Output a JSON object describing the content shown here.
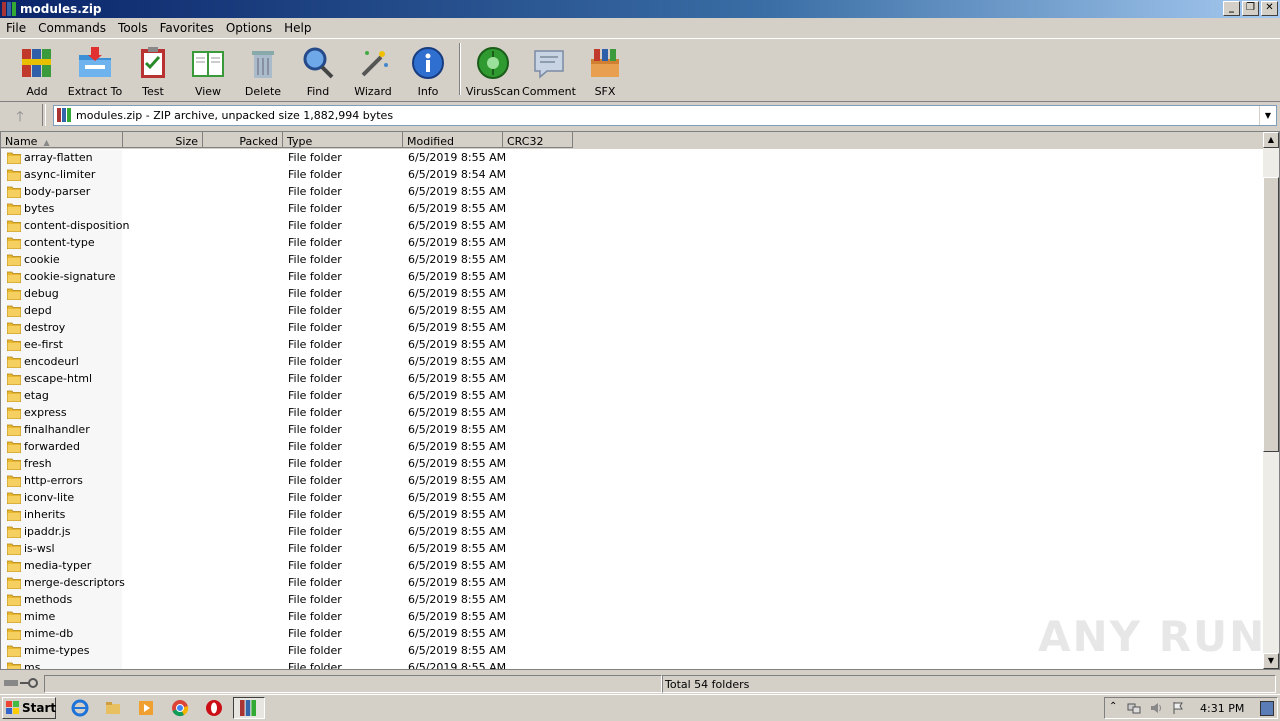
{
  "window": {
    "title": "modules.zip"
  },
  "menu": [
    "File",
    "Commands",
    "Tools",
    "Favorites",
    "Options",
    "Help"
  ],
  "toolbar": [
    {
      "label": "Add",
      "icon": "add-archive-icon"
    },
    {
      "label": "Extract To",
      "icon": "extract-folder-icon"
    },
    {
      "label": "Test",
      "icon": "test-clipboard-icon"
    },
    {
      "label": "View",
      "icon": "view-book-icon"
    },
    {
      "label": "Delete",
      "icon": "trash-can-icon"
    },
    {
      "label": "Find",
      "icon": "magnifier-icon"
    },
    {
      "label": "Wizard",
      "icon": "magic-wand-icon"
    },
    {
      "label": "Info",
      "icon": "info-icon"
    },
    {
      "label": "VirusScan",
      "icon": "virus-scan-icon"
    },
    {
      "label": "Comment",
      "icon": "comment-icon"
    },
    {
      "label": "SFX",
      "icon": "sfx-box-icon"
    }
  ],
  "address": {
    "text": "modules.zip - ZIP archive, unpacked size 1,882,994 bytes"
  },
  "columns": [
    "Name",
    "Size",
    "Packed",
    "Type",
    "Modified",
    "CRC32"
  ],
  "rows": [
    {
      "name": "array-flatten",
      "type": "File folder",
      "modified": "6/5/2019 8:55 AM"
    },
    {
      "name": "async-limiter",
      "type": "File folder",
      "modified": "6/5/2019 8:54 AM"
    },
    {
      "name": "body-parser",
      "type": "File folder",
      "modified": "6/5/2019 8:55 AM"
    },
    {
      "name": "bytes",
      "type": "File folder",
      "modified": "6/5/2019 8:55 AM"
    },
    {
      "name": "content-disposition",
      "type": "File folder",
      "modified": "6/5/2019 8:55 AM"
    },
    {
      "name": "content-type",
      "type": "File folder",
      "modified": "6/5/2019 8:55 AM"
    },
    {
      "name": "cookie",
      "type": "File folder",
      "modified": "6/5/2019 8:55 AM"
    },
    {
      "name": "cookie-signature",
      "type": "File folder",
      "modified": "6/5/2019 8:55 AM"
    },
    {
      "name": "debug",
      "type": "File folder",
      "modified": "6/5/2019 8:55 AM"
    },
    {
      "name": "depd",
      "type": "File folder",
      "modified": "6/5/2019 8:55 AM"
    },
    {
      "name": "destroy",
      "type": "File folder",
      "modified": "6/5/2019 8:55 AM"
    },
    {
      "name": "ee-first",
      "type": "File folder",
      "modified": "6/5/2019 8:55 AM"
    },
    {
      "name": "encodeurl",
      "type": "File folder",
      "modified": "6/5/2019 8:55 AM"
    },
    {
      "name": "escape-html",
      "type": "File folder",
      "modified": "6/5/2019 8:55 AM"
    },
    {
      "name": "etag",
      "type": "File folder",
      "modified": "6/5/2019 8:55 AM"
    },
    {
      "name": "express",
      "type": "File folder",
      "modified": "6/5/2019 8:55 AM"
    },
    {
      "name": "finalhandler",
      "type": "File folder",
      "modified": "6/5/2019 8:55 AM"
    },
    {
      "name": "forwarded",
      "type": "File folder",
      "modified": "6/5/2019 8:55 AM"
    },
    {
      "name": "fresh",
      "type": "File folder",
      "modified": "6/5/2019 8:55 AM"
    },
    {
      "name": "http-errors",
      "type": "File folder",
      "modified": "6/5/2019 8:55 AM"
    },
    {
      "name": "iconv-lite",
      "type": "File folder",
      "modified": "6/5/2019 8:55 AM"
    },
    {
      "name": "inherits",
      "type": "File folder",
      "modified": "6/5/2019 8:55 AM"
    },
    {
      "name": "ipaddr.js",
      "type": "File folder",
      "modified": "6/5/2019 8:55 AM"
    },
    {
      "name": "is-wsl",
      "type": "File folder",
      "modified": "6/5/2019 8:55 AM"
    },
    {
      "name": "media-typer",
      "type": "File folder",
      "modified": "6/5/2019 8:55 AM"
    },
    {
      "name": "merge-descriptors",
      "type": "File folder",
      "modified": "6/5/2019 8:55 AM"
    },
    {
      "name": "methods",
      "type": "File folder",
      "modified": "6/5/2019 8:55 AM"
    },
    {
      "name": "mime",
      "type": "File folder",
      "modified": "6/5/2019 8:55 AM"
    },
    {
      "name": "mime-db",
      "type": "File folder",
      "modified": "6/5/2019 8:55 AM"
    },
    {
      "name": "mime-types",
      "type": "File folder",
      "modified": "6/5/2019 8:55 AM"
    },
    {
      "name": "ms",
      "type": "File folder",
      "modified": "6/5/2019 8:55 AM"
    }
  ],
  "status": {
    "total": "Total 54 folders"
  },
  "taskbar": {
    "start": "Start",
    "clock": "4:31 PM"
  },
  "watermark": "ANY RUN"
}
